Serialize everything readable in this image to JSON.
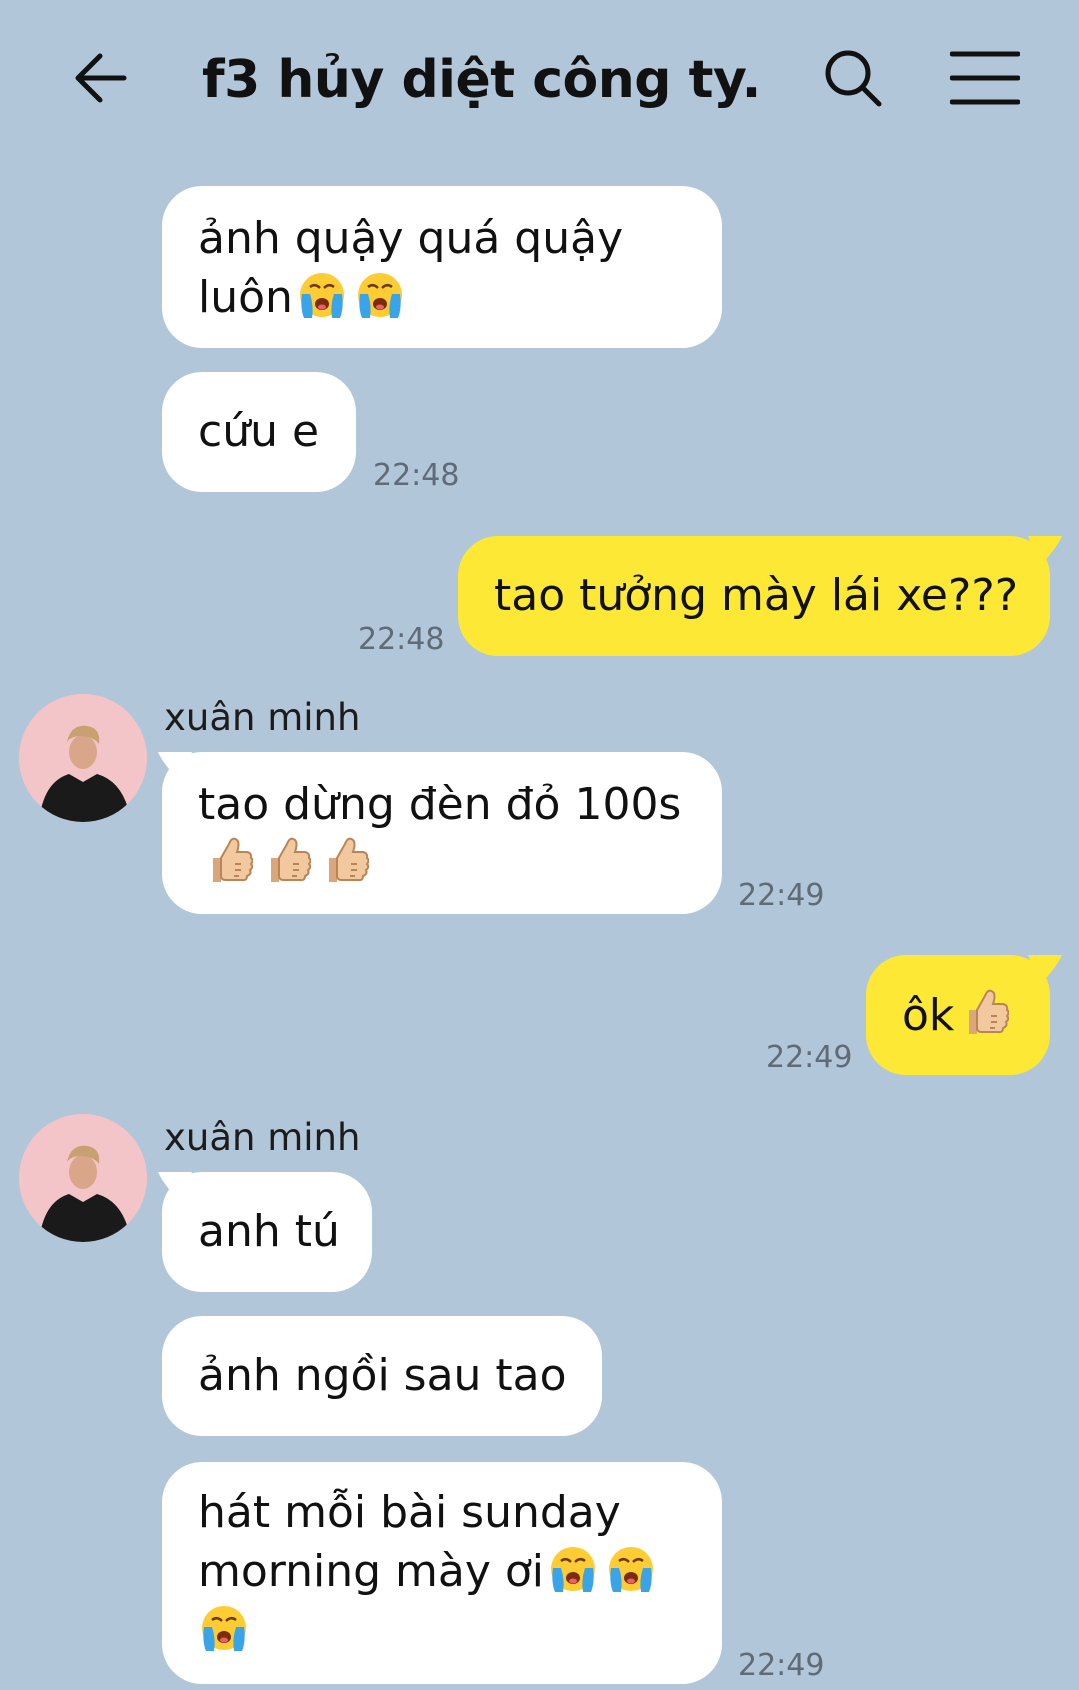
{
  "header": {
    "title": "f3 hủy diệt công ty...",
    "back_icon": "arrow-left-icon",
    "search_icon": "search-icon",
    "menu_icon": "menu-icon"
  },
  "colors": {
    "background": "#b2c6d9",
    "incoming_bubble": "#ffffff",
    "outgoing_bubble": "#fde935",
    "timestamp": "#5f6b76"
  },
  "messages": [
    {
      "direction": "incoming",
      "lines": [
        "ảnh quậy quá quậy",
        "luôn"
      ],
      "emoji": [
        "crying-face",
        "crying-face"
      ],
      "time": ""
    },
    {
      "direction": "incoming",
      "lines": [
        "cứu e"
      ],
      "emoji": [],
      "time": "22:48"
    },
    {
      "direction": "outgoing",
      "lines": [
        "tao tưởng mày lái xe???"
      ],
      "emoji": [],
      "time": "22:48"
    },
    {
      "direction": "incoming",
      "sender": "xuân minh",
      "lines": [
        "tao dừng đèn đỏ 100s"
      ],
      "emoji": [
        "thumbs-up",
        "thumbs-up",
        "thumbs-up"
      ],
      "time": "22:49"
    },
    {
      "direction": "outgoing",
      "lines": [
        "ôk"
      ],
      "emoji": [
        "thumbs-up"
      ],
      "time": "22:49"
    },
    {
      "direction": "incoming",
      "sender": "xuân minh",
      "lines": [
        "anh tú"
      ],
      "emoji": [],
      "time": ""
    },
    {
      "direction": "incoming",
      "lines": [
        "ảnh ngồi sau tao"
      ],
      "emoji": [],
      "time": ""
    },
    {
      "direction": "incoming",
      "lines": [
        "hát mỗi bài sunday",
        "morning mày ơi"
      ],
      "emoji": [
        "crying-face",
        "crying-face",
        "crying-face"
      ],
      "time": "22:49"
    }
  ]
}
